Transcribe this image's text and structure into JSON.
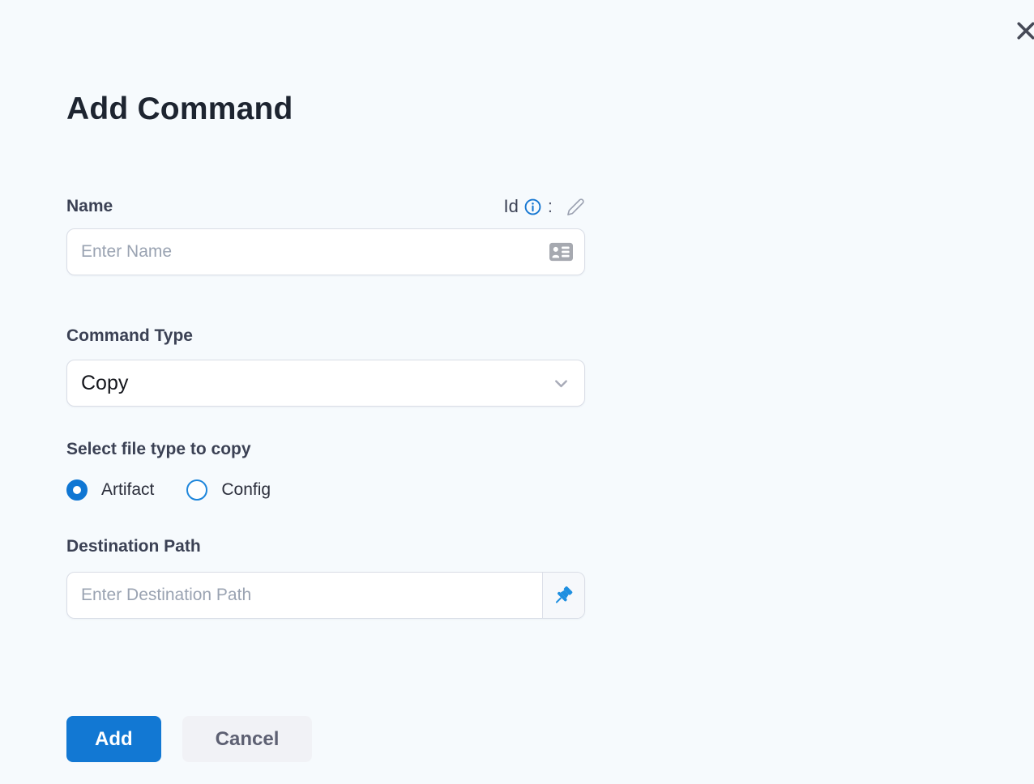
{
  "window": {
    "background_color": "#f6fafd"
  },
  "modal": {
    "title": "Add Command"
  },
  "form": {
    "name": {
      "label": "Name",
      "id_label": "Id",
      "colon": ":",
      "input_value": "",
      "input_placeholder": "Enter Name"
    },
    "command_type": {
      "label": "Command Type",
      "selected_value": "Copy"
    },
    "file_type": {
      "label": "Select file type to copy",
      "options": [
        {
          "label": "Artifact",
          "selected": true
        },
        {
          "label": "Config",
          "selected": false
        }
      ]
    },
    "destination_path": {
      "label": "Destination Path",
      "input_value": "",
      "input_placeholder": "Enter Destination Path"
    }
  },
  "actions": {
    "add_label": "Add",
    "cancel_label": "Cancel"
  },
  "icons": {
    "close": "x-icon",
    "name_id_info": "info-circle-icon",
    "name_id_edit": "pencil-icon",
    "name_suffix": "contact-card-icon",
    "dropdown": "chevron-down-icon",
    "destination_suffix": "pushpin-icon"
  },
  "colors": {
    "accent_blue": "#1278d3",
    "radio_blue": "#0f76d3",
    "pin_blue": "#1e8fe0",
    "info_blue": "#1677d2",
    "title_text": "#1d2430",
    "label_text": "#3b4154",
    "input_text": "#171922",
    "placeholder_text": "#9aa3b2",
    "border": "#d9dde6",
    "cancel_bg": "#f1f2f6",
    "cancel_text": "#5d6072",
    "close_icon": "#464a57"
  }
}
